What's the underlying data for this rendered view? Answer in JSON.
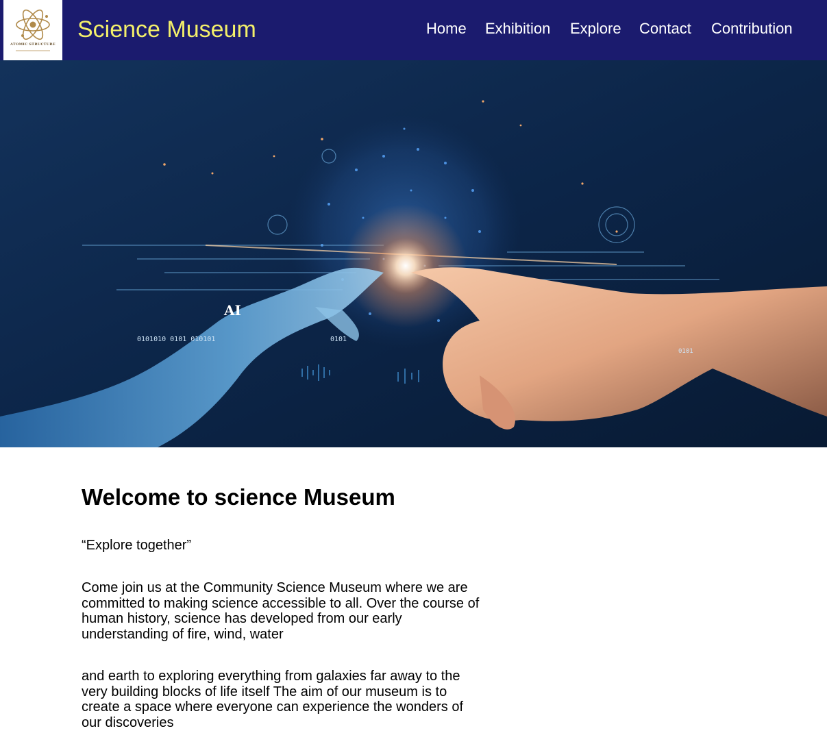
{
  "header": {
    "logo": {
      "icon": "atom-icon",
      "caption": "ATOMIC STRUCTURE"
    },
    "title": "Science Museum",
    "nav": [
      {
        "label": "Home"
      },
      {
        "label": "Exhibition"
      },
      {
        "label": "Explore"
      },
      {
        "label": "Contact"
      },
      {
        "label": "Contribution"
      }
    ]
  },
  "hero": {
    "image": "robot-hand-touching-human-hand",
    "ai_label": "AI",
    "binary_left": "0101010 0101 010101",
    "binary_mid": "0101",
    "binary_right": "0101"
  },
  "main": {
    "heading": "Welcome to science Museum",
    "tagline": "“Explore together”",
    "paragraphs": [
      "Come join us at the Community Science Museum where we are committed to making science accessible to all. Over the course of human history, science has developed from our early understanding of fire, wind, water",
      "and earth to exploring everything from galaxies far away to the very building blocks of life itself The aim of our museum is to create a space where everyone can experience the wonders of our discoveries"
    ]
  },
  "colors": {
    "header_bg": "#1b1b6e",
    "title_color": "#f4f06a",
    "nav_color": "#ffffff"
  }
}
